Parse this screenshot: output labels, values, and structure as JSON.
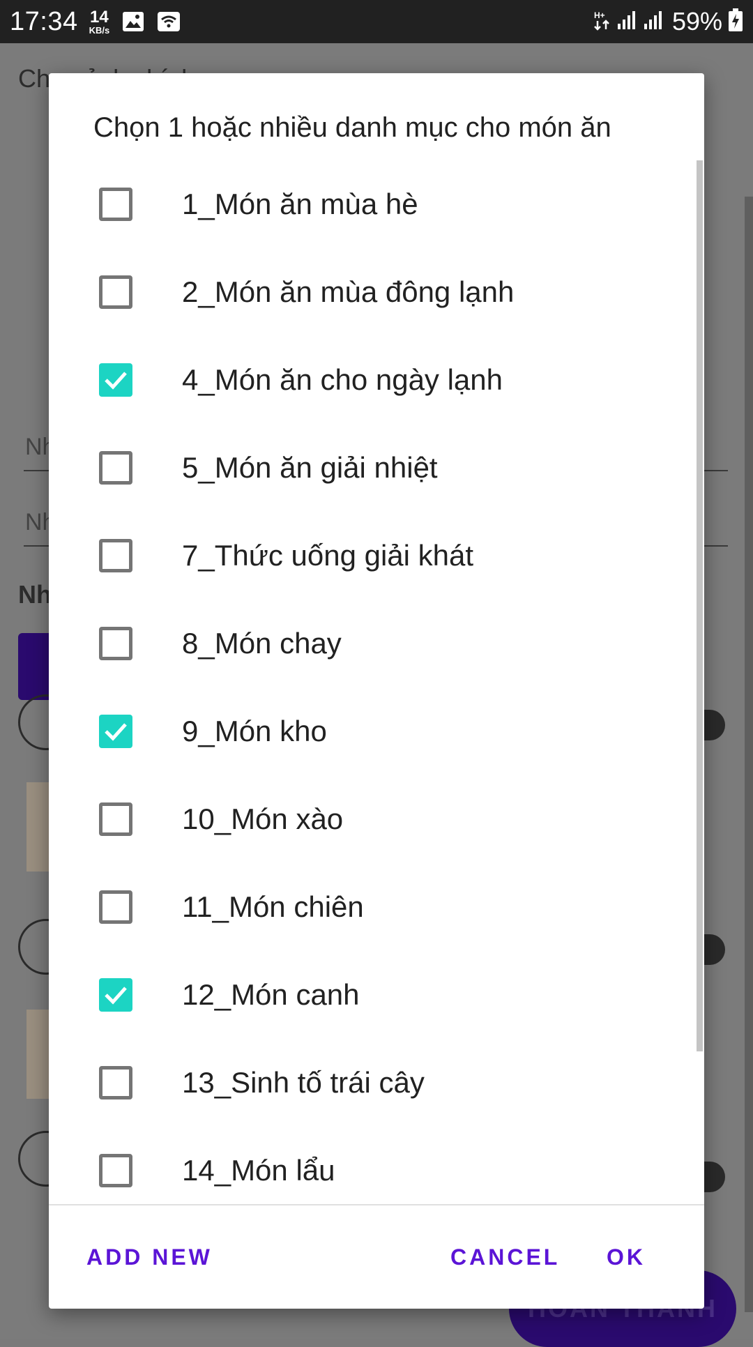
{
  "status_bar": {
    "time": "17:34",
    "speed_value": "14",
    "speed_unit": "KB/s",
    "battery": "59%"
  },
  "background": {
    "title_label": "Chọn ảnh chính:",
    "field1_hint": "Nh",
    "field2_hint": "Nh",
    "section_label": "Nh",
    "finish_button": "HOÀN THÀNH"
  },
  "dialog": {
    "title": "Chọn 1 hoặc nhiều danh mục cho món ăn",
    "items": [
      {
        "label": "1_Món ăn mùa hè",
        "checked": false
      },
      {
        "label": "2_Món ăn mùa đông lạnh",
        "checked": false
      },
      {
        "label": "4_Món ăn cho ngày lạnh",
        "checked": true
      },
      {
        "label": "5_Món ăn giải nhiệt",
        "checked": false
      },
      {
        "label": "7_Thức uống giải khát",
        "checked": false
      },
      {
        "label": "8_Món chay",
        "checked": false
      },
      {
        "label": "9_Món kho",
        "checked": true
      },
      {
        "label": "10_Món xào",
        "checked": false
      },
      {
        "label": "11_Món chiên",
        "checked": false
      },
      {
        "label": "12_Món canh",
        "checked": true
      },
      {
        "label": "13_Sinh tố trái cây",
        "checked": false
      },
      {
        "label": "14_Món lẩu",
        "checked": false
      }
    ],
    "buttons": {
      "add_new": "ADD NEW",
      "cancel": "CANCEL",
      "ok": "OK"
    },
    "accent_color": "#1cd4c3",
    "button_color": "#5b14d6"
  }
}
